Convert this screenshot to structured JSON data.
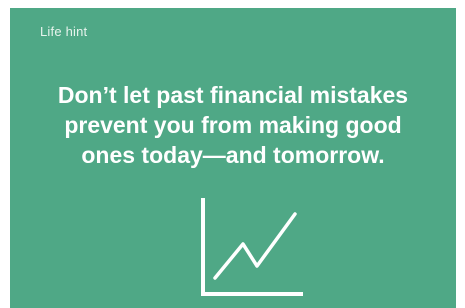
{
  "card": {
    "background_color": "#4fa886",
    "label": "Life hint",
    "headline_lines": [
      "Don’t let past financial mistakes",
      "prevent you from making good",
      "ones today—and tomorrow."
    ],
    "icon": "line-chart-icon",
    "icon_color": "#ffffff"
  }
}
